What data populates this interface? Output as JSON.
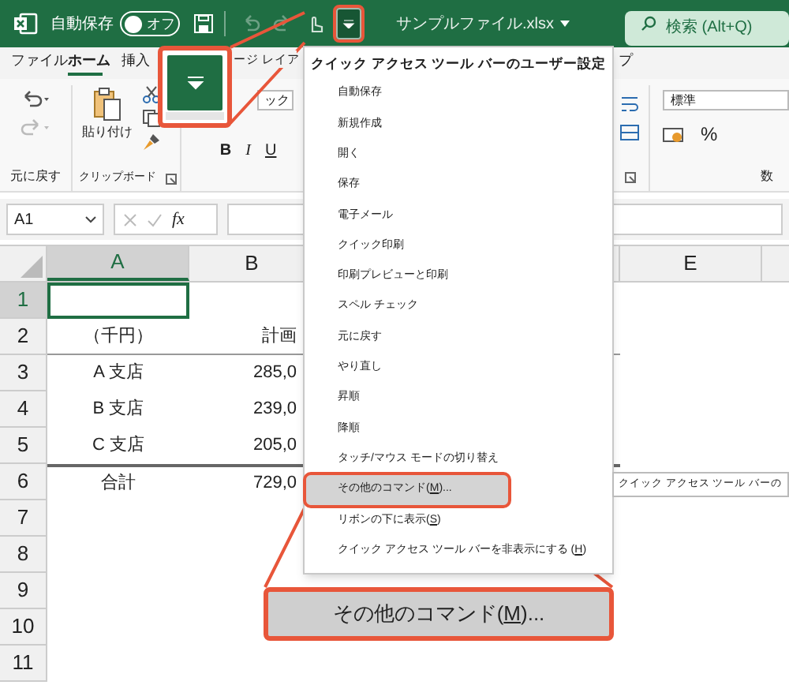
{
  "title_bar": {
    "autosave_label": "自動保存",
    "autosave": {
      "on": false,
      "label": "オフ"
    },
    "file_name": "サンプルファイル.xlsx",
    "search": {
      "placeholder": "検索 (Alt+Q)"
    }
  },
  "ribbon_tabs": [
    {
      "label": "ファイル",
      "selected": false
    },
    {
      "label": "ホーム",
      "selected": true
    },
    {
      "label": "挿入",
      "selected": false
    },
    {
      "label": "ージ レイア",
      "selected": false
    },
    {
      "label": "プ",
      "selected": false
    }
  ],
  "ribbon": {
    "font_name": "ック",
    "bold": "B",
    "italic": "I",
    "underline": "U",
    "paste_label": "貼り付け",
    "undo_group": "元に戻す",
    "clipboard_group": "クリップボード",
    "number_format": "標準",
    "percent": "%",
    "number_group": "数"
  },
  "formula_bar": {
    "name_box": "A1",
    "fx": "fx"
  },
  "sheet": {
    "columns": [
      {
        "label": "A",
        "selected": true
      },
      {
        "label": "B",
        "selected": false
      },
      {
        "label": "E",
        "selected": false
      }
    ],
    "rows": [
      {
        "number": "1",
        "selected": true,
        "kind": "blank"
      },
      {
        "number": "2",
        "selected": false,
        "kind": "header",
        "cells": [
          "（千円）",
          "計画"
        ]
      },
      {
        "number": "3",
        "selected": false,
        "kind": "data",
        "cells": [
          "A 支店",
          "285,0"
        ]
      },
      {
        "number": "4",
        "selected": false,
        "kind": "data",
        "cells": [
          "B 支店",
          "239,0"
        ]
      },
      {
        "number": "5",
        "selected": false,
        "kind": "data",
        "cells": [
          "C 支店",
          "205,0"
        ]
      },
      {
        "number": "6",
        "selected": false,
        "kind": "total",
        "cells": [
          "合計",
          "729,0"
        ]
      },
      {
        "number": "7",
        "selected": false,
        "kind": "blank"
      },
      {
        "number": "8",
        "selected": false,
        "kind": "blank"
      },
      {
        "number": "9",
        "selected": false,
        "kind": "blank"
      },
      {
        "number": "10",
        "selected": false,
        "kind": "blank"
      },
      {
        "number": "11",
        "selected": false,
        "kind": "blank"
      }
    ]
  },
  "menu": {
    "title": "クイック アクセス ツール バーのユーザー設定",
    "items": [
      {
        "label": "自動保存",
        "selected": false
      },
      {
        "label": "新規作成",
        "selected": false
      },
      {
        "label": "開く",
        "selected": false
      },
      {
        "label": "保存",
        "selected": false
      },
      {
        "label": "電子メール",
        "selected": false
      },
      {
        "label": "クイック印刷",
        "selected": false
      },
      {
        "label": "印刷プレビューと印刷",
        "selected": false
      },
      {
        "label": "スペル チェック",
        "selected": false
      },
      {
        "label": "元に戻す",
        "selected": false
      },
      {
        "label": "やり直し",
        "selected": false
      },
      {
        "label": "昇順",
        "selected": false
      },
      {
        "label": "降順",
        "selected": false
      },
      {
        "label": "タッチ/マウス モードの切り替え",
        "selected": false
      },
      {
        "label": "その他のコマンド(",
        "access_key": "M",
        "label_end": ")...",
        "selected": true
      },
      {
        "label": "リボンの下に表示(",
        "access_key": "S",
        "label_end": ")",
        "selected": false
      },
      {
        "label": "クイック アクセス ツール バーを非表示にする (",
        "access_key": "H",
        "label_end": ")",
        "selected": false
      }
    ]
  },
  "tooltip": "クイック アクセス ツール バーの",
  "callout": {
    "label": "その他のコマンド(",
    "access_key": "M",
    "label_end": ")..."
  }
}
